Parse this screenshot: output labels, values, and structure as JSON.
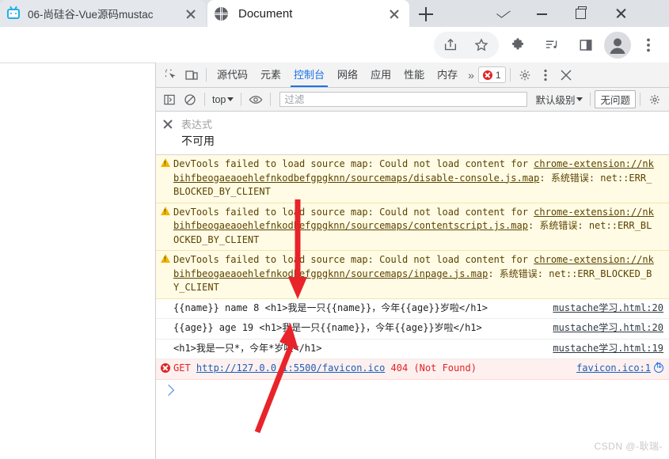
{
  "browser": {
    "tabs": [
      {
        "title": "06-尚硅谷-Vue源码mustac",
        "favicon": "bilibili-tv-icon",
        "active": false
      },
      {
        "title": "Document",
        "favicon": "globe-icon",
        "active": true
      }
    ],
    "new_tab_label": "+",
    "window_controls": [
      "tab-search-chevron",
      "minimize",
      "maximize",
      "close"
    ],
    "toolbar_icons": [
      "share-icon",
      "bookmark-star-icon",
      "extensions-puzzle-icon",
      "media-list-icon",
      "side-panel-icon",
      "profile-avatar-icon",
      "browser-menu-icon"
    ]
  },
  "devtools": {
    "tabs": [
      {
        "label": "源代码",
        "selected": false
      },
      {
        "label": "元素",
        "selected": false
      },
      {
        "label": "控制台",
        "selected": true
      },
      {
        "label": "网络",
        "selected": false
      },
      {
        "label": "应用",
        "selected": false
      },
      {
        "label": "性能",
        "selected": false
      },
      {
        "label": "内存",
        "selected": false
      }
    ],
    "more_tabs": "»",
    "error_count": "1",
    "left_buttons": [
      "inspect-element-icon",
      "device-toolbar-icon"
    ],
    "right_buttons": [
      "devtools-settings-gear-icon",
      "devtools-more-options-icon",
      "devtools-close-icon"
    ],
    "console_toolbar": {
      "sidebar_toggle": "console-sidebar-icon",
      "clear_label": "clear-console-icon",
      "context_selector": "top",
      "eye_label": "live-expression-eye-icon",
      "filter_placeholder": "过滤",
      "level_selector": "默认级别",
      "issues_label": "无问题",
      "settings_gear": "console-settings-gear-icon"
    },
    "watch_pane": {
      "close_label": "close-expression-icon",
      "title": "表达式",
      "value": "不可用"
    },
    "messages": [
      {
        "type": "warning",
        "parts": [
          {
            "t": "DevTools failed to load source map: Could not load content for ",
            "k": "text"
          },
          {
            "t": "chrome-extension://nkbihfbeogaeaoehlefnkodbefgpgknn/sourcemaps/disable-console.js.map",
            "k": "link"
          },
          {
            "t": ": 系统错误: net::ERR_BLOCKED_BY_CLIENT",
            "k": "text"
          }
        ],
        "source": ""
      },
      {
        "type": "warning",
        "parts": [
          {
            "t": "DevTools failed to load source map: Could not load content for ",
            "k": "text"
          },
          {
            "t": "chrome-extension://nkbihfbeogaeaoehlefnkodbefgpgknn/sourcemaps/contentscript.js.map",
            "k": "link"
          },
          {
            "t": ": 系统错误: net::ERR_BLOCKED_BY_CLIENT",
            "k": "text"
          }
        ],
        "source": ""
      },
      {
        "type": "warning",
        "parts": [
          {
            "t": "DevTools failed to load source map: Could not load content for ",
            "k": "text"
          },
          {
            "t": "chrome-extension://nkbihfbeogaeaoehlefnkodbefgpgknn/sourcemaps/inpage.js.map",
            "k": "link"
          },
          {
            "t": ": 系统错误: net::ERR_BLOCKED_BY_CLIENT",
            "k": "text"
          }
        ],
        "source": ""
      },
      {
        "type": "log",
        "parts": [
          {
            "t": "{{name}} name 8 <h1>我是一只{{name}}，今年{{age}}岁啦</h1>",
            "k": "text"
          }
        ],
        "source": "mustache学习.html:20"
      },
      {
        "type": "log",
        "parts": [
          {
            "t": "{{age}} age 19 <h1>我是一只{{name}}，今年{{age}}岁啦</h1>",
            "k": "text"
          }
        ],
        "source": "mustache学习.html:20"
      },
      {
        "type": "log",
        "parts": [
          {
            "t": "<h1>我是一只*，今年*岁啦</h1>",
            "k": "text"
          }
        ],
        "source": "mustache学习.html:19"
      },
      {
        "type": "error",
        "parts": [
          {
            "t": "GET ",
            "k": "text"
          },
          {
            "t": "http://127.0.0.1:5500/favicon.ico",
            "k": "url"
          },
          {
            "t": " 404 (Not Found)",
            "k": "text"
          }
        ],
        "source": "favicon.ico:1",
        "has_network_icon": true
      }
    ],
    "prompt_symbol": ">"
  },
  "annotations": {
    "arrows": [
      "down-arrow-over-warnings",
      "up-arrow-to-log-line"
    ],
    "color": "#e8242a"
  },
  "watermark": "CSDN @-耿瑞-"
}
